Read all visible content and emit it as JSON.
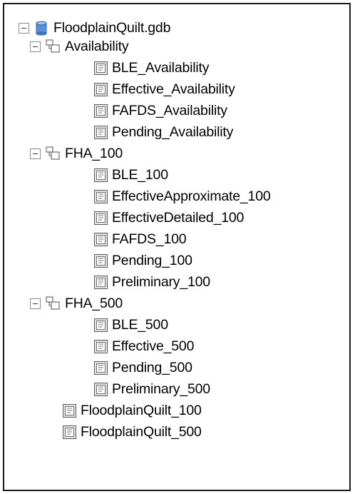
{
  "tree": {
    "root": {
      "label": "FloodplainQuilt.gdb",
      "icon": "geodatabase-icon",
      "expanded": true
    },
    "datasets": [
      {
        "label": "Availability",
        "icon": "feature-dataset-icon",
        "expanded": true,
        "children": [
          "BLE_Availability",
          "Effective_Availability",
          "FAFDS_Availability",
          "Pending_Availability"
        ]
      },
      {
        "label": "FHA_100",
        "icon": "feature-dataset-icon",
        "expanded": true,
        "children": [
          "BLE_100",
          "EffectiveApproximate_100",
          "EffectiveDetailed_100",
          "FAFDS_100",
          "Pending_100",
          "Preliminary_100"
        ]
      },
      {
        "label": "FHA_500",
        "icon": "feature-dataset-icon",
        "expanded": true,
        "children": [
          "BLE_500",
          "Effective_500",
          "Pending_500",
          "Preliminary_500"
        ]
      }
    ],
    "root_items": [
      "FloodplainQuilt_100",
      "FloodplainQuilt_500"
    ],
    "item_icon": "raster-catalog-icon"
  }
}
